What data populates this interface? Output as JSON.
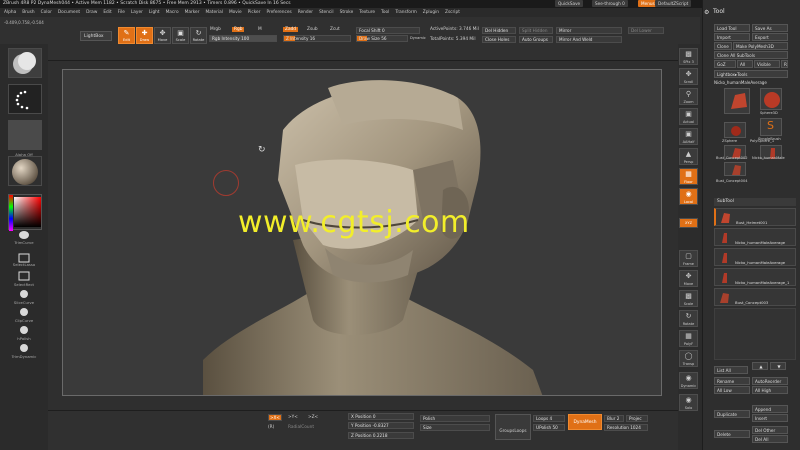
{
  "titlebar": {
    "text": "ZBrush 4R8 P2    DynaMesh044    • Active Mem 1182 • Scratch Disk 8675 • Free Mem 2913 • Timers 0.896 • QuickSave In 16 Secs",
    "quicksave": "QuickSave",
    "seethrough": "See-through  0",
    "menus": "Menus",
    "defaultscript": "DefaultZScript"
  },
  "menubar": [
    "Alpha",
    "Brush",
    "Color",
    "Document",
    "Draw",
    "Edit",
    "File",
    "Layer",
    "Light",
    "Macro",
    "Marker",
    "Material",
    "Movie",
    "Picker",
    "Preferences",
    "Render",
    "Stencil",
    "Stroke",
    "Texture",
    "Tool",
    "Transform",
    "Zplugin",
    "Zscript"
  ],
  "coord": "-0.409,0.758,-0.504",
  "toolbar": {
    "lightbox": "LightBox",
    "edit": "Edit",
    "draw": "Draw",
    "move": "Move",
    "scale": "Scale",
    "rotate": "Rotate",
    "mrgb": "Mrgb",
    "rgb": "Rgb",
    "m": "M",
    "zadd": "Zadd",
    "zsub": "Zsub",
    "zcut": "Zcut",
    "rgb_intensity": "Rgb Intensity 100",
    "z_intensity": "Z Intensity 16",
    "focal_shift": "Focal Shift 0",
    "draw_size": "Draw Size 56",
    "dynamic": "Dynamic",
    "active_points": "ActivePoints: 3.746 Mil",
    "total_points": "TotalPoints: 5.394 Mil",
    "del_hidden": "Del Hidden",
    "close_holes": "Close Holes",
    "split_hidden": "Split Hidden",
    "auto_groups": "Auto Groups",
    "mirror": "Mirror",
    "mirror_weld": "Mirror And Weld",
    "del_lower": "Del Lower"
  },
  "leftshelf": {
    "alpha_label": "Alpha Off",
    "texture_label": "Texture Off",
    "tools": [
      "TrimCurve",
      "SelectLasso",
      "SelectRect",
      "SliceCurve",
      "ClipCurve",
      "hPolish",
      "TrimDynamic"
    ]
  },
  "rightshelf": [
    "SPix 3",
    "Scroll",
    "Zoom",
    "Actual",
    "AAHalf",
    "Persp",
    "Floor",
    "Local",
    "Frame",
    "Move",
    "Scale",
    "Rotate",
    "PolyF",
    "Transp",
    "Dynamic",
    "Solo"
  ],
  "tray": {
    "title": "Tool",
    "load_tool": "Load Tool",
    "save_as": "Save As",
    "import": "Import",
    "export": "Export",
    "clone": "Clone",
    "make_polymesh": "Make PolyMesh3D",
    "clone_all": "Clone All SubTools",
    "goz": "GoZ",
    "all": "All",
    "visible": "Visible",
    "r": "R",
    "lightbox_tools": "Lightbox▸Tools",
    "current_tool": "Nicko_humanMaleAverage",
    "thumbs": [
      "Sphere3D",
      "SimpleBrush",
      "ZSphere",
      "PolySphere_1",
      "Bust_Concept002",
      "Nicko_humanMale",
      "Bust_Concept004"
    ],
    "subtool_header": "SubTool",
    "subtools": [
      "Bust_Helmet001",
      "Nicko_humanMaleAverage",
      "Nicko_humanMaleAverage",
      "Nicko_humanMaleAverage_1",
      "Bust_Concept003"
    ],
    "list_all": "List All",
    "rename": "Rename",
    "autoreorder": "AutoReorder",
    "all_low": "All Low",
    "all_high": "All High",
    "duplicate": "Duplicate",
    "append": "Append",
    "insert": "Insert",
    "delete": "Delete",
    "del_other": "Del Other",
    "del_all": "Del All"
  },
  "bottombar": {
    "xyz": ">X<",
    "y": ">Y<",
    "z": ">Z<",
    "radial": "(R)",
    "radial_count": "RadialCount",
    "x_position": "X Position 0",
    "y_position": "Y Position -0.8327",
    "z_position": "Z Position 0.2218",
    "polish": "Polish",
    "size": "Size",
    "group_loops": "GroupsLoops",
    "loops": "Loops 4",
    "upolish": "UPolish 50",
    "dynamesh": "DynaMesh",
    "blur": "Blur 2",
    "project": "Projec",
    "resolution": "Resolution 1024"
  },
  "watermark": "www.cgtsj.com",
  "colors": {
    "accent": "#e07016",
    "watermark": "#f2ee2a",
    "background": "#2b2b2b"
  }
}
